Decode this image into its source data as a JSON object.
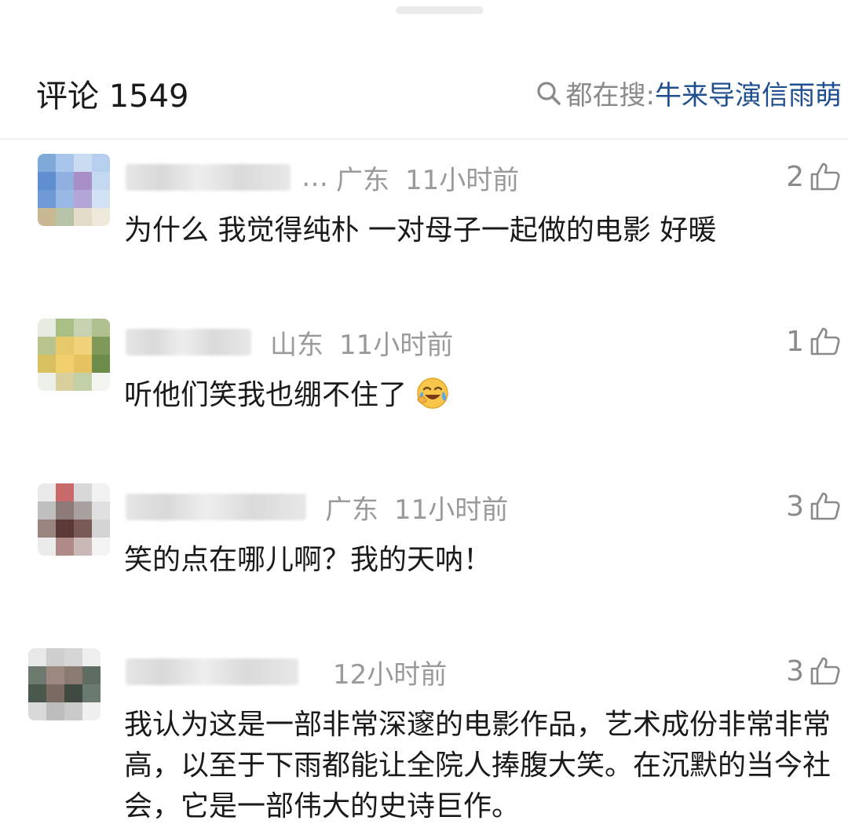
{
  "header": {
    "title": "评论 1549",
    "search_prefix": "都在搜:",
    "search_term": "牛来导演信雨萌"
  },
  "comments": [
    {
      "name_suffix": "…",
      "location": "广东",
      "time": "11小时前",
      "likes": "2",
      "text": "为什么 我觉得纯朴 一对母子一起做的电影 好暖"
    },
    {
      "name_suffix": "",
      "location": "山东",
      "time": "11小时前",
      "likes": "1",
      "text": "听他们笑我也绷不住了"
    },
    {
      "name_suffix": "",
      "location": "广东",
      "time": "11小时前",
      "likes": "3",
      "text": "笑的点在哪儿啊？我的天呐！"
    },
    {
      "name_suffix": "",
      "location": "",
      "time": "12小时前",
      "likes": "3",
      "text": "我认为这是一部非常深邃的电影作品，艺术成份非常非常高，以至于下雨都能让全院人捧腹大笑。在沉默的当今社会，它是一部伟大的史诗巨作。"
    }
  ],
  "colors": {
    "accent": "#1f4f8f",
    "meta": "#9a9a9a"
  },
  "icons": {
    "search": "search-icon",
    "like": "thumb-up-icon",
    "emoji": "laugh-cry-emoji"
  }
}
